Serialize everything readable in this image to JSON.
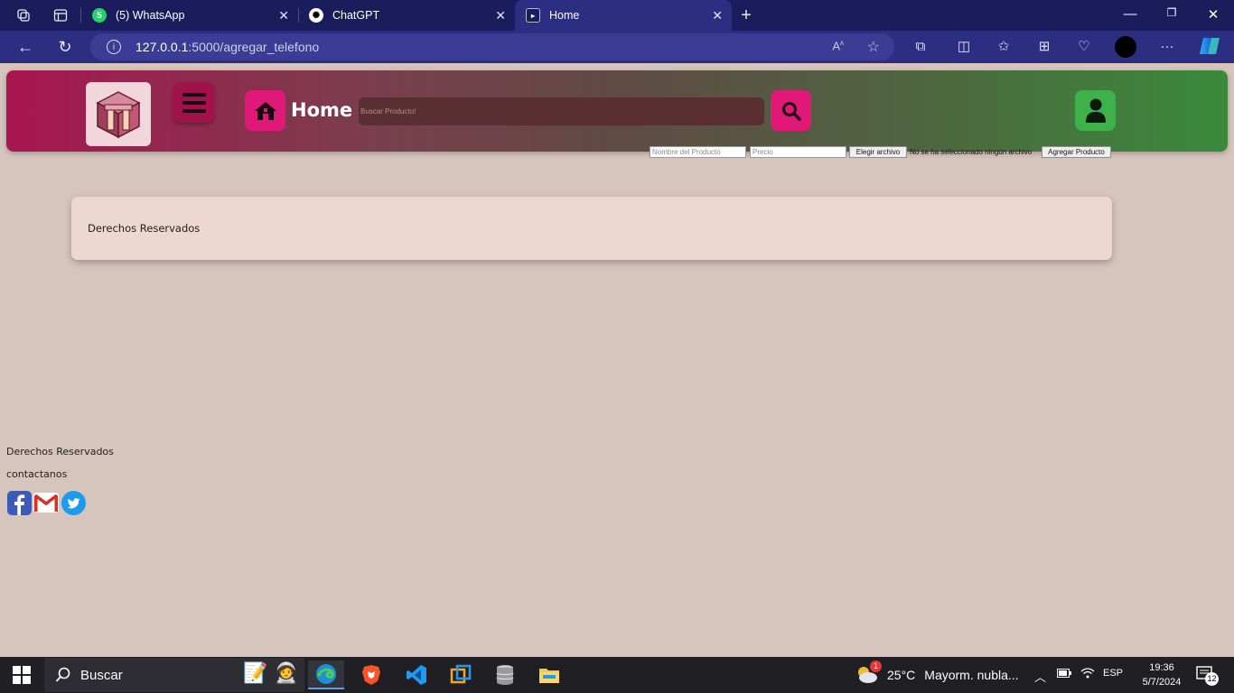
{
  "browser": {
    "tabs": [
      {
        "label": "(5) WhatsApp",
        "badge": "5"
      },
      {
        "label": "ChatGPT"
      },
      {
        "label": "Home"
      }
    ],
    "url_host": "127.0.0.1",
    "url_path": ":5000/agregar_telefono"
  },
  "header": {
    "title": "Home",
    "search_placeholder": "Buscar Producto!"
  },
  "form": {
    "name_placeholder": "Nombre del Producto",
    "price_placeholder": "Precio",
    "file_button": "Elegir archivo",
    "file_status": "No se ha seleccionado ningún archivo",
    "submit_button": "Agregar Producto"
  },
  "card": {
    "text": "Derechos Reservados"
  },
  "footer": {
    "rights": "Derechos Reservados",
    "contact": "contactanos"
  },
  "taskbar": {
    "search_label": "Buscar",
    "weather_temp": "25°C",
    "weather_desc": "Mayorm. nubla...",
    "weather_badge": "1",
    "language": "ESP",
    "time": "19:36",
    "date": "5/7/2024",
    "notifications": "12"
  },
  "colors": {
    "brand_pink": "#e01878",
    "brand_green": "#3fb14a",
    "chrome": "#1b1c5c"
  }
}
